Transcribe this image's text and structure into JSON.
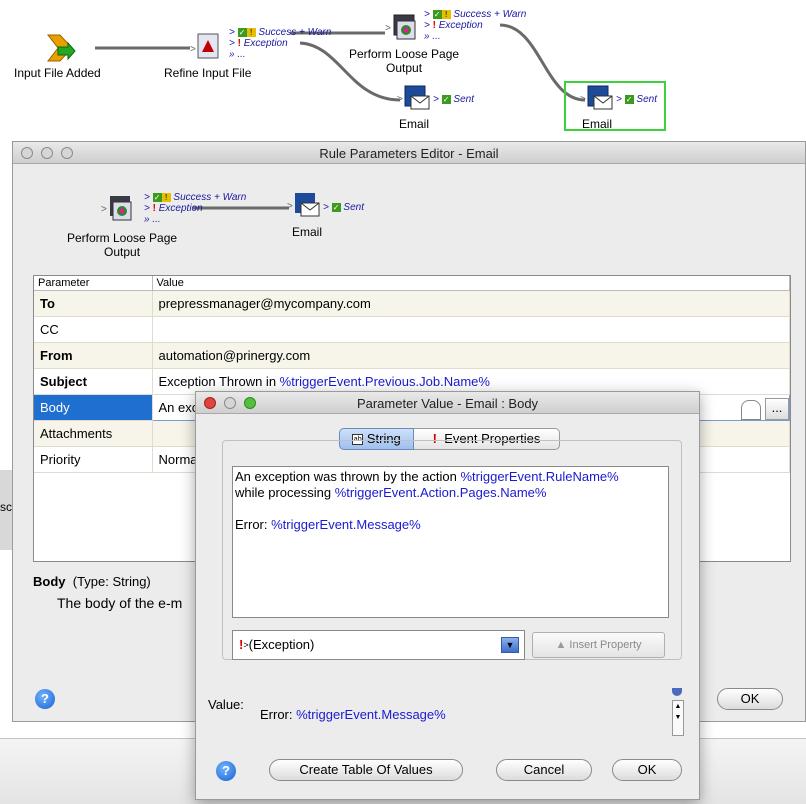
{
  "workflow": {
    "nodes": {
      "input": "Input File Added",
      "refine": "Refine Input File",
      "loose": [
        "Perform Loose Page",
        "Output"
      ],
      "email1": "Email",
      "email2": "Email"
    },
    "outputs": {
      "success_warn": "Success + Warn",
      "exception": "Exception",
      "more": "...",
      "sent": "Sent"
    }
  },
  "rule_editor": {
    "title": "Rule Parameters Editor - Email",
    "mini_flow": {
      "loose": [
        "Perform Loose Page",
        "Output"
      ],
      "email": "Email",
      "success_warn": "Success + Warn",
      "exception": "Exception",
      "more": "...",
      "sent": "Sent"
    },
    "table": {
      "headers": [
        "Parameter",
        "Value"
      ],
      "rows": [
        {
          "param": "To",
          "value": "prepressmanager@mycompany.com"
        },
        {
          "param": "CC",
          "value": ""
        },
        {
          "param": "From",
          "value": "automation@prinergy.com"
        },
        {
          "param": "Subject",
          "value_prefix": "Exception Thrown in ",
          "value_link": "%triggerEvent.Previous.Job.Name%"
        },
        {
          "param": "Body",
          "value": "An exc"
        },
        {
          "param": "Attachments",
          "value": ""
        },
        {
          "param": "Priority",
          "value": "Norma"
        }
      ]
    },
    "description": {
      "name": "Body",
      "type": "(Type: String)",
      "text": "The body of the e-m"
    },
    "ok_label": "OK",
    "browse_label": "...",
    "help_label": "?"
  },
  "param_dialog": {
    "title": "Parameter Value - Email : Body",
    "tabs": [
      "String",
      "Event Properties"
    ],
    "text": {
      "line1_prefix": "An exception was thrown by the action ",
      "line1_link": "%triggerEvent.RuleName%",
      "line2_prefix": "while processing ",
      "line2_link": "%triggerEvent.Action.Pages.Name%",
      "line4_prefix": "Error: ",
      "line4_link": "%triggerEvent.Message%"
    },
    "dropdown_value": "(Exception)",
    "insert_property": "Insert Property",
    "value_label": "Value:",
    "value_prefix": "Error: ",
    "value_link": "%triggerEvent.Message%",
    "buttons": {
      "create_table": "Create Table Of Values",
      "cancel": "Cancel",
      "ok": "OK"
    },
    "help_label": "?"
  },
  "colors": {
    "selection": "#1f6fd0",
    "link": "#1a1ad0",
    "highlight": "#3cd23c"
  }
}
